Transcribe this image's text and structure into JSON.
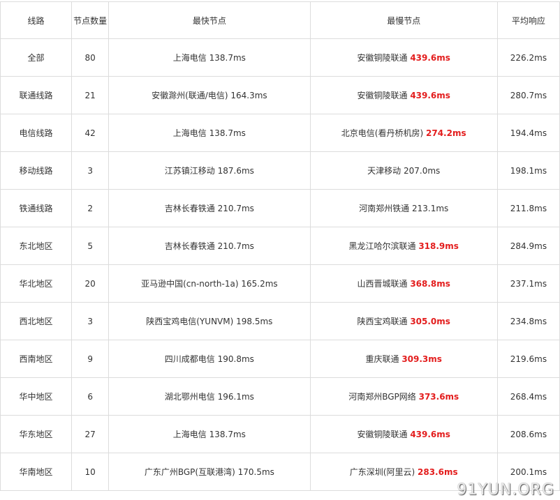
{
  "headers": [
    "线路",
    "节点数量",
    "最快节点",
    "最慢节点",
    "平均响应"
  ],
  "rows": [
    {
      "route": "全部",
      "count": "80",
      "fast_name": "上海电信",
      "fast_ms": "138.7ms",
      "slow_name": "安徽铜陵联通",
      "slow_ms": "439.6ms",
      "slow_red": true,
      "avg": "226.2ms"
    },
    {
      "route": "联通线路",
      "count": "21",
      "fast_name": "安徽滁州(联通/电信)",
      "fast_ms": "164.3ms",
      "slow_name": "安徽铜陵联通",
      "slow_ms": "439.6ms",
      "slow_red": true,
      "avg": "280.7ms"
    },
    {
      "route": "电信线路",
      "count": "42",
      "fast_name": "上海电信",
      "fast_ms": "138.7ms",
      "slow_name": "北京电信(看丹桥机房)",
      "slow_ms": "274.2ms",
      "slow_red": true,
      "avg": "194.4ms"
    },
    {
      "route": "移动线路",
      "count": "3",
      "fast_name": "江苏镇江移动",
      "fast_ms": "187.6ms",
      "slow_name": "天津移动",
      "slow_ms": "207.0ms",
      "slow_red": false,
      "avg": "198.1ms"
    },
    {
      "route": "铁通线路",
      "count": "2",
      "fast_name": "吉林长春铁通",
      "fast_ms": "210.7ms",
      "slow_name": "河南郑州铁通",
      "slow_ms": "213.1ms",
      "slow_red": false,
      "avg": "211.8ms"
    },
    {
      "route": "东北地区",
      "count": "5",
      "fast_name": "吉林长春铁通",
      "fast_ms": "210.7ms",
      "slow_name": "黑龙江哈尔滨联通",
      "slow_ms": "318.9ms",
      "slow_red": true,
      "avg": "284.9ms"
    },
    {
      "route": "华北地区",
      "count": "20",
      "fast_name": "亚马逊中国(cn-north-1a)",
      "fast_ms": "165.2ms",
      "slow_name": "山西晋城联通",
      "slow_ms": "368.8ms",
      "slow_red": true,
      "avg": "237.1ms"
    },
    {
      "route": "西北地区",
      "count": "3",
      "fast_name": "陕西宝鸡电信(YUNVM)",
      "fast_ms": "198.5ms",
      "slow_name": "陕西宝鸡联通",
      "slow_ms": "305.0ms",
      "slow_red": true,
      "avg": "234.8ms"
    },
    {
      "route": "西南地区",
      "count": "9",
      "fast_name": "四川成都电信",
      "fast_ms": "190.8ms",
      "slow_name": "重庆联通",
      "slow_ms": "309.3ms",
      "slow_red": true,
      "avg": "219.6ms"
    },
    {
      "route": "华中地区",
      "count": "6",
      "fast_name": "湖北鄂州电信",
      "fast_ms": "196.1ms",
      "slow_name": "河南郑州BGP网络",
      "slow_ms": "373.6ms",
      "slow_red": true,
      "avg": "268.4ms"
    },
    {
      "route": "华东地区",
      "count": "27",
      "fast_name": "上海电信",
      "fast_ms": "138.7ms",
      "slow_name": "安徽铜陵联通",
      "slow_ms": "439.6ms",
      "slow_red": true,
      "avg": "208.6ms"
    },
    {
      "route": "华南地区",
      "count": "10",
      "fast_name": "广东广州BGP(互联港湾)",
      "fast_ms": "170.5ms",
      "slow_name": "广东深圳(阿里云)",
      "slow_ms": "283.6ms",
      "slow_red": true,
      "avg": "200.1ms"
    }
  ],
  "watermark": "91YUN.ORG",
  "colors": {
    "red_ms": "#e31d1d",
    "border": "#dcdcdc",
    "text": "#333333"
  }
}
